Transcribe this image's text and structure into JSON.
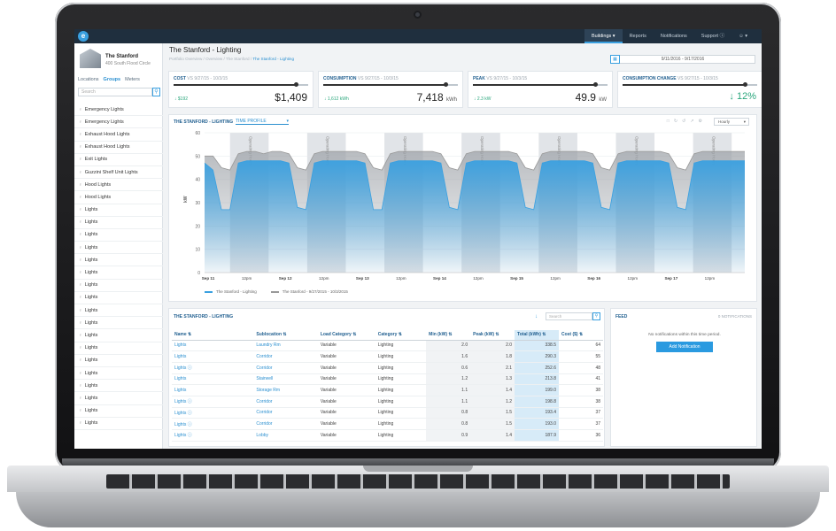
{
  "nav": {
    "items": [
      {
        "label": "Buildings ▾",
        "active": true
      },
      {
        "label": "Reports",
        "active": false
      },
      {
        "label": "Notifications",
        "active": false
      },
      {
        "label": "Support ⓘ",
        "active": false
      },
      {
        "label": "☺ ▾",
        "active": false
      }
    ]
  },
  "sidebar": {
    "building_name": "The Stanford",
    "building_address": "400 South Flood Circle",
    "tabs": [
      "Locations",
      "Groups",
      "Meters"
    ],
    "active_tab": "Groups",
    "search_placeholder": "Search",
    "items": [
      "Emergency Lights",
      "Emergency Lights",
      "Exhaust Hood Lights",
      "Exhaust Hood Lights",
      "Exit Lights",
      "Guzzini Shelf Unit Lights",
      "Hood Lights",
      "Hood Lights",
      "Lights",
      "Lights",
      "Lights",
      "Lights",
      "Lights",
      "Lights",
      "Lights",
      "Lights",
      "Lights",
      "Lights",
      "Lights",
      "Lights",
      "Lights",
      "Lights",
      "Lights",
      "Lights",
      "Lights",
      "Lights"
    ]
  },
  "header": {
    "title": "The Stanford - Lighting",
    "breadcrumb_prefix": "Portfolio Overview  /  Overview  /  The Stanford  /",
    "breadcrumb_current": "The Stanford - Lighting",
    "date_range": "9/11/2016  -  9/17/2016"
  },
  "kpis": [
    {
      "title": "COST",
      "compare": "VS 9/27/15 - 10/3/15",
      "delta": "↓ $192",
      "value": "$1,409",
      "unit": ""
    },
    {
      "title": "CONSUMPTION",
      "compare": "VS 9/27/15 - 10/3/15",
      "delta": "↓ 1,612 kWh",
      "value": "7,418",
      "unit": "kWh"
    },
    {
      "title": "PEAK",
      "compare": "VS 9/27/15 - 10/3/15",
      "delta": "↓ 2.3 kW",
      "value": "49.9",
      "unit": "kW"
    },
    {
      "title": "CONSUMPTION CHANGE",
      "compare": "VS 9/27/15 - 10/3/15",
      "delta": "",
      "value": "↓  12%",
      "unit": ""
    }
  ],
  "chart_panel": {
    "title": "THE STANFORD - LIGHTING",
    "view_select": "TIME PROFILE",
    "interval_select": "Hourly",
    "legend": [
      "The Stanford - Lighting",
      "The Stanford - 9/27/2015 - 10/3/2015"
    ],
    "band_label": "Operating Hours"
  },
  "chart_data": {
    "type": "area",
    "ylabel": "kW",
    "ylim": [
      0,
      60
    ],
    "yticks": [
      0,
      10,
      20,
      30,
      40,
      50,
      60
    ],
    "xticks": [
      "Sep 11",
      "12pm",
      "Sep 12",
      "12pm",
      "Sep 13",
      "12pm",
      "Sep 14",
      "12pm",
      "Sep 15",
      "12pm",
      "Sep 16",
      "12pm",
      "Sep 17",
      "12pm"
    ],
    "series": [
      {
        "name": "The Stanford - Lighting",
        "color": "#3aa0e0",
        "values": [
          47,
          44,
          27,
          27,
          47,
          48,
          48,
          48,
          48,
          48,
          47,
          28,
          27,
          47,
          48,
          48,
          48,
          48,
          48,
          47,
          27,
          27,
          47,
          48,
          48,
          48,
          48,
          48,
          47,
          28,
          27,
          47,
          48,
          48,
          48,
          48,
          48,
          47,
          28,
          27,
          47,
          48,
          48,
          48,
          48,
          48,
          47,
          28,
          27,
          47,
          48,
          48,
          48,
          48,
          48,
          47,
          28,
          27,
          47,
          48,
          48,
          48,
          48,
          48,
          48
        ]
      },
      {
        "name": "The Stanford - 9/27/2015 - 10/3/2015",
        "color": "#999999",
        "values": [
          50,
          50,
          45,
          44,
          51,
          52,
          52,
          51,
          52,
          52,
          51,
          45,
          44,
          51,
          52,
          52,
          52,
          52,
          52,
          51,
          45,
          44,
          51,
          52,
          52,
          52,
          52,
          52,
          51,
          45,
          44,
          51,
          52,
          52,
          52,
          52,
          52,
          51,
          45,
          44,
          51,
          52,
          52,
          52,
          52,
          52,
          51,
          45,
          44,
          51,
          52,
          52,
          52,
          52,
          52,
          51,
          45,
          44,
          51,
          52,
          52,
          52,
          52,
          52,
          52
        ]
      }
    ]
  },
  "table": {
    "title": "THE STANFORD - LIGHTING",
    "search_placeholder": "Search",
    "columns": [
      "Name",
      "Sublocation",
      "Load Category",
      "Category",
      "Min (kW)",
      "Peak (kW)",
      "Total (kWh)",
      "Cost ($)"
    ],
    "rows": [
      [
        "Lights",
        "Laundry Rm",
        "Variable",
        "Lighting",
        "2.0",
        "2.0",
        "338.5",
        "64"
      ],
      [
        "Lights",
        "Corridor",
        "Variable",
        "Lighting",
        "1.6",
        "1.8",
        "290.3",
        "55"
      ],
      [
        "Lights ⓘ",
        "Corridor",
        "Variable",
        "Lighting",
        "0.6",
        "2.1",
        "252.6",
        "48"
      ],
      [
        "Lights",
        "Stairwell",
        "Variable",
        "Lighting",
        "1.2",
        "1.3",
        "213.8",
        "41"
      ],
      [
        "Lights",
        "Storage Rm",
        "Variable",
        "Lighting",
        "1.1",
        "1.4",
        "199.0",
        "38"
      ],
      [
        "Lights ⓘ",
        "Corridor",
        "Variable",
        "Lighting",
        "1.1",
        "1.2",
        "198.8",
        "38"
      ],
      [
        "Lights ⓘ",
        "Corridor",
        "Variable",
        "Lighting",
        "0.8",
        "1.5",
        "193.4",
        "37"
      ],
      [
        "Lights ⓘ",
        "Corridor",
        "Variable",
        "Lighting",
        "0.8",
        "1.5",
        "193.0",
        "37"
      ],
      [
        "Lights ⓘ",
        "Lobby",
        "Variable",
        "Lighting",
        "0.9",
        "1.4",
        "187.9",
        "36"
      ]
    ]
  },
  "feed": {
    "title": "FEED",
    "count_label": "0 NOTIFICATIONS",
    "empty_text": "No notifications within this time period.",
    "button_label": "Add Notification"
  }
}
